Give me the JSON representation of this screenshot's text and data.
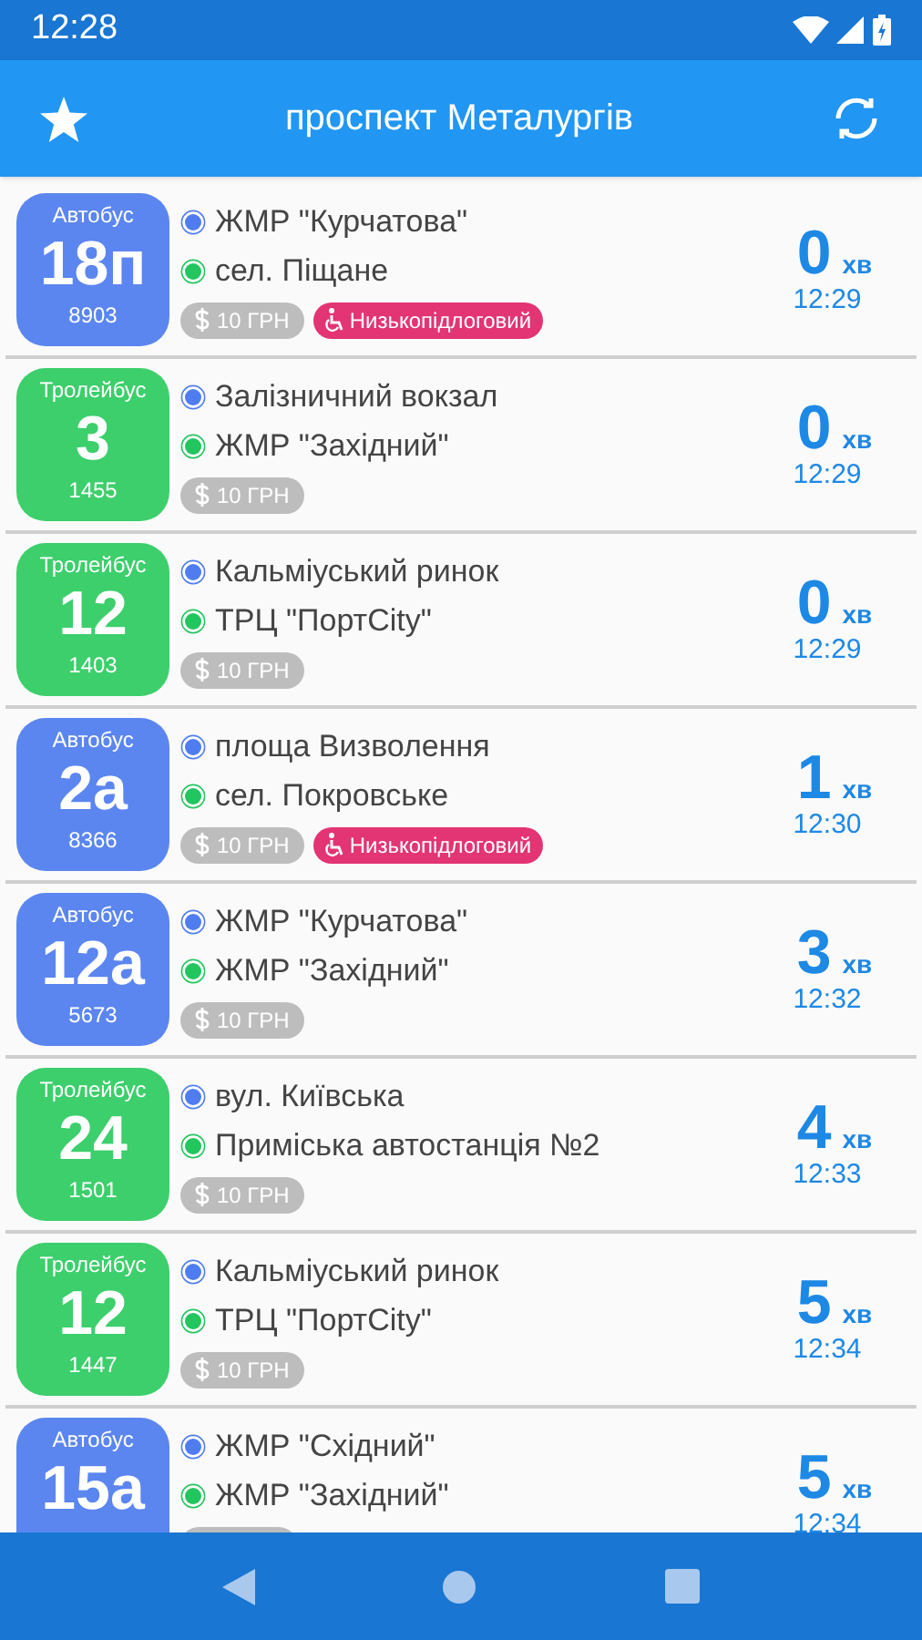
{
  "status_bar": {
    "time": "12:28"
  },
  "app_bar": {
    "title": "проспект Металургів"
  },
  "arrivals": [
    {
      "kind": "bus",
      "type": "Автобус",
      "route": "18п",
      "number": "8903",
      "from": "ЖМР \"Курчатова\"",
      "to": "сел. Піщане",
      "fare": "10 ГРН",
      "accessibility": "Низькопідлоговий",
      "minutes": "0",
      "unit": "хв",
      "time": "12:29"
    },
    {
      "kind": "trolleybus",
      "type": "Тролейбус",
      "route": "3",
      "number": "1455",
      "from": "Залізничний вокзал",
      "to": "ЖМР \"Західний\"",
      "fare": "10 ГРН",
      "minutes": "0",
      "unit": "хв",
      "time": "12:29"
    },
    {
      "kind": "trolleybus",
      "type": "Тролейбус",
      "route": "12",
      "number": "1403",
      "from": "Кальміуський ринок",
      "to": "ТРЦ \"ПортCity\"",
      "fare": "10 ГРН",
      "minutes": "0",
      "unit": "хв",
      "time": "12:29"
    },
    {
      "kind": "bus",
      "type": "Автобус",
      "route": "2а",
      "number": "8366",
      "from": "площа Визволення",
      "to": "сел. Покровське",
      "fare": "10 ГРН",
      "accessibility": "Низькопідлоговий",
      "minutes": "1",
      "unit": "хв",
      "time": "12:30"
    },
    {
      "kind": "bus",
      "type": "Автобус",
      "route": "12а",
      "number": "5673",
      "from": "ЖМР \"Курчатова\"",
      "to": "ЖМР \"Західний\"",
      "fare": "10 ГРН",
      "minutes": "3",
      "unit": "хв",
      "time": "12:32"
    },
    {
      "kind": "trolleybus",
      "type": "Тролейбус",
      "route": "24",
      "number": "1501",
      "from": "вул. Київська",
      "to": "Приміська автостанція №2",
      "fare": "10 ГРН",
      "minutes": "4",
      "unit": "хв",
      "time": "12:33"
    },
    {
      "kind": "trolleybus",
      "type": "Тролейбус",
      "route": "12",
      "number": "1447",
      "from": "Кальміуський ринок",
      "to": "ТРЦ \"ПортCity\"",
      "fare": "10 ГРН",
      "minutes": "5",
      "unit": "хв",
      "time": "12:34"
    },
    {
      "kind": "bus",
      "type": "Автобус",
      "route": "15а",
      "from": "ЖМР \"Східний\"",
      "to": "ЖМР \"Західний\"",
      "minutes": "5",
      "unit": "хв",
      "time": "12:34"
    }
  ]
}
